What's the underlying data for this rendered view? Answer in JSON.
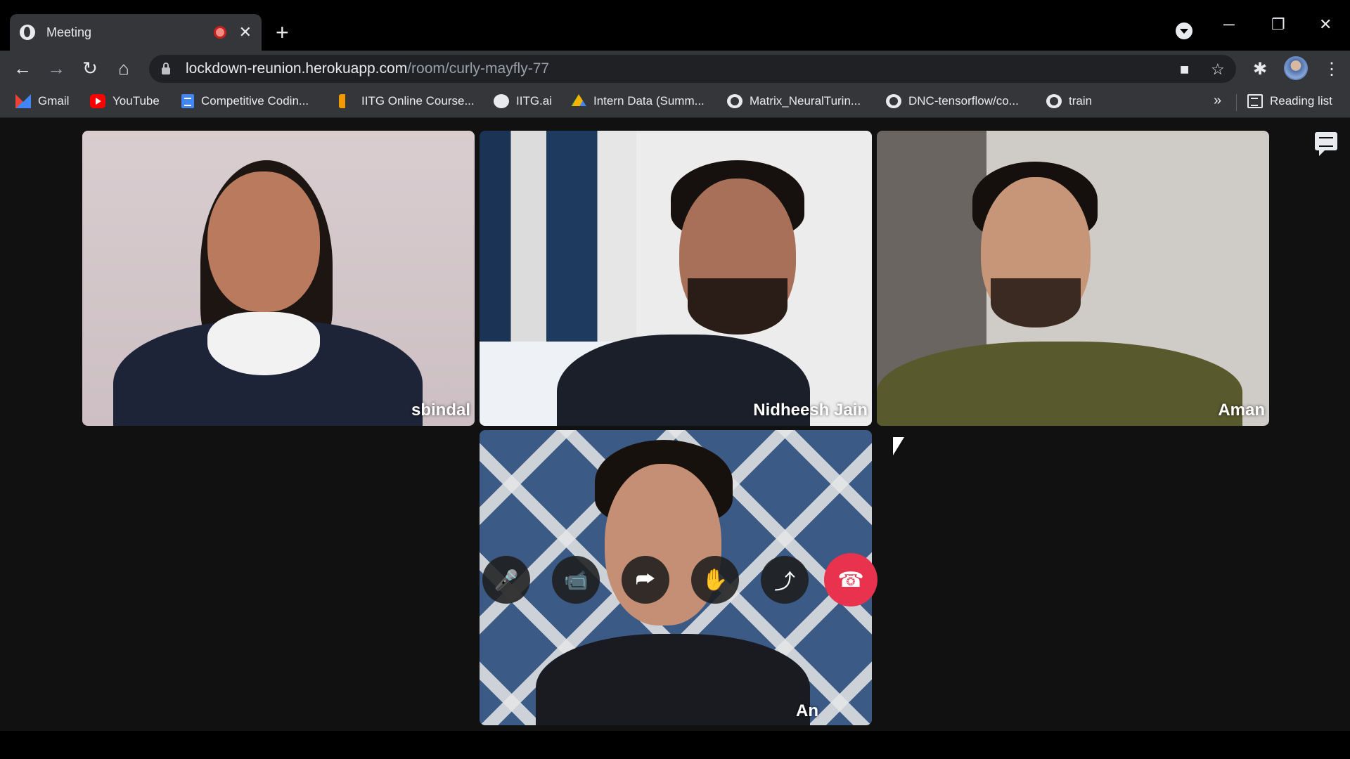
{
  "tab": {
    "title": "Meeting",
    "close": "✕",
    "new": "+"
  },
  "window": {
    "minimize": "─",
    "restore": "❐",
    "close": "✕"
  },
  "toolbar": {
    "back": "←",
    "forward": "→",
    "reload": "↻",
    "home": "⌂",
    "url_host": "lockdown-reunion.herokuapp.com",
    "url_path": "/room/curly-mayfly-77",
    "camera": "■",
    "star": "☆",
    "extensions": "✱",
    "menu": "⋮"
  },
  "bookmarks": [
    {
      "label": "Gmail",
      "icon": "gmail-icon"
    },
    {
      "label": "YouTube",
      "icon": "youtube-icon"
    },
    {
      "label": "Competitive Codin...",
      "icon": "docs-icon"
    },
    {
      "label": "IITG Online Course...",
      "icon": "iitg-icon"
    },
    {
      "label": "IITG.ai",
      "icon": "iitg-ai-icon"
    },
    {
      "label": "Intern Data (Summ...",
      "icon": "drive-icon"
    },
    {
      "label": "Matrix_NeuralTurin...",
      "icon": "github-icon"
    },
    {
      "label": "DNC-tensorflow/co...",
      "icon": "github-icon"
    },
    {
      "label": "train",
      "icon": "github-icon"
    }
  ],
  "bookmarks_more": "»",
  "reading_list": "Reading list",
  "participants": [
    {
      "name": "sbindal"
    },
    {
      "name": "Nidheesh Jain"
    },
    {
      "name": "Aman"
    },
    {
      "name": "An"
    }
  ],
  "controls": {
    "mic": "🎤",
    "camera": "📹",
    "screen": "⮫",
    "hand": "✋",
    "share": "⤴",
    "hangup": "☎"
  },
  "colors": {
    "hangup": "#e8324e",
    "background": "#111111",
    "chrome": "#35363a"
  }
}
